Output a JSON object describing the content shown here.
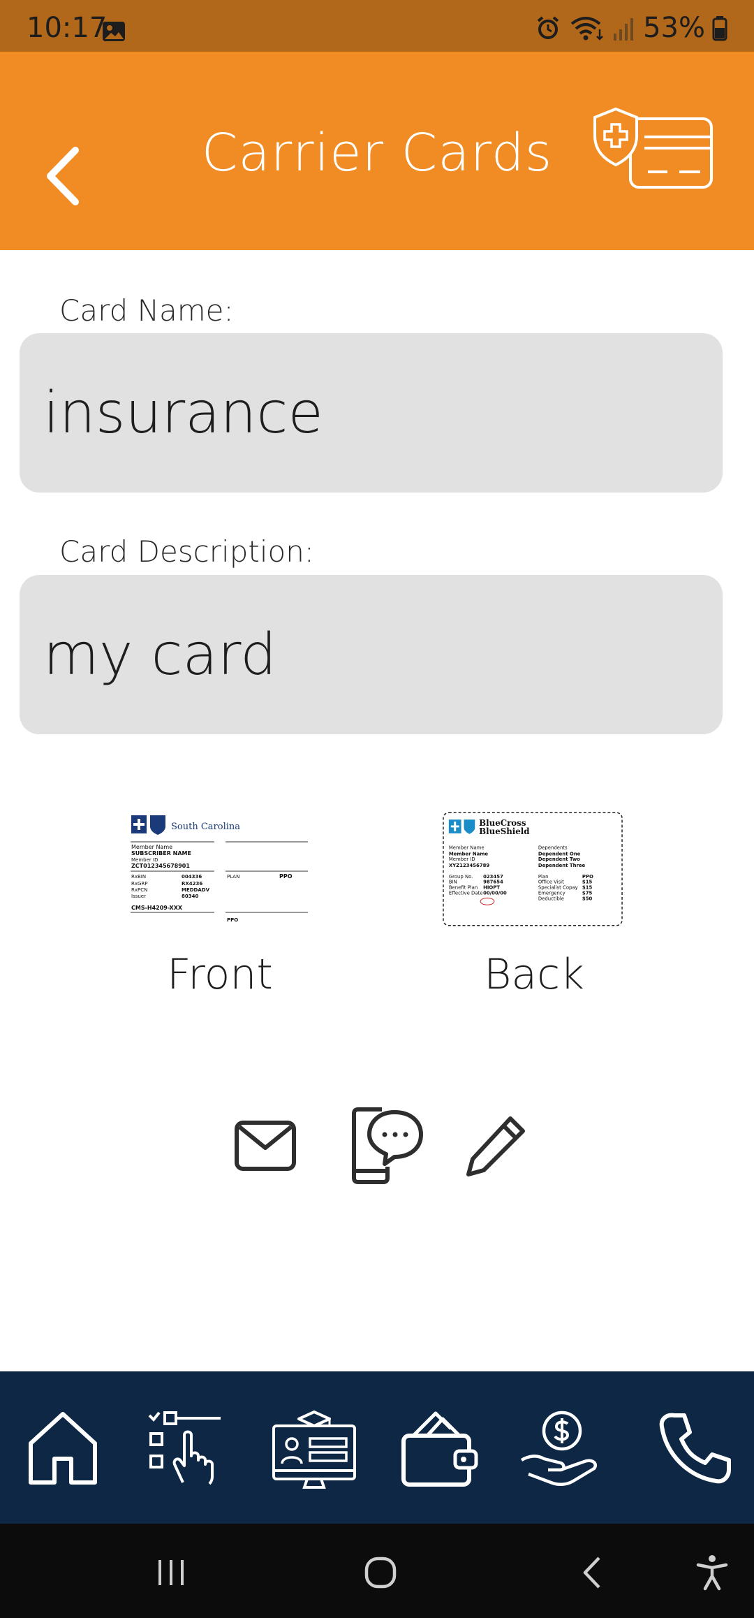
{
  "status_bar": {
    "time": "10:17",
    "battery": "53%"
  },
  "header": {
    "title": "Carrier Cards",
    "back_icon": "chevron-left-icon",
    "card_icon": "health-card-icon",
    "background": "#f08c23"
  },
  "form": {
    "card_name_label": "Card Name:",
    "card_name_value": "insurance",
    "card_description_label": "Card Description:",
    "card_description_value": "my card"
  },
  "card_images": {
    "front": {
      "caption": "Front",
      "brand": "South Carolina",
      "member_name_label": "Member Name",
      "member_name": "SUBSCRIBER NAME",
      "member_id_label": "Member ID",
      "member_id": "ZCT012345678901",
      "rxbin_label": "RxBIN",
      "rxbin": "004336",
      "rxgrp_label": "RxGRP",
      "rxgrp": "RX4236",
      "rxpcn_label": "RxPCN",
      "rxpcn": "MEDDADV",
      "issuer_label": "Issuer",
      "issuer": "80340",
      "plan_label": "PLAN",
      "plan": "PPO",
      "cms": "CMS-H4209-XXX",
      "ppo_mark": "PPO"
    },
    "back": {
      "caption": "Back",
      "brand_line1": "BlueCross",
      "brand_line2": "BlueShield",
      "left_labels": [
        "Member Name",
        "Member Name",
        "Member ID",
        "XYZ123456789",
        "Group No.",
        "BIN",
        "Benefit Plan",
        "Effective Date"
      ],
      "left_values": [
        "",
        "",
        "",
        "",
        "023457",
        "987654",
        "HIOPT",
        "00/00/00"
      ],
      "right_header": "Dependents",
      "dependents": [
        "Dependent One",
        "Dependent Two",
        "Dependent Three"
      ],
      "right_labels": [
        "Plan",
        "Office Visit",
        "Specialist Copay",
        "Emergency",
        "Deductible"
      ],
      "right_values": [
        "PPO",
        "$15",
        "$15",
        "$75",
        "$50"
      ]
    }
  },
  "actions": {
    "email_icon": "envelope-icon",
    "message_icon": "phone-chat-icon",
    "edit_icon": "pencil-icon"
  },
  "bottom_nav": {
    "items": [
      "home-icon",
      "checklist-icon",
      "education-icon",
      "wallet-icon",
      "money-hand-icon",
      "phone-icon"
    ],
    "background": "#0d2744"
  },
  "system_nav": {
    "items": [
      "recent-apps-icon",
      "home-circle-icon",
      "back-icon",
      "accessibility-icon"
    ]
  }
}
